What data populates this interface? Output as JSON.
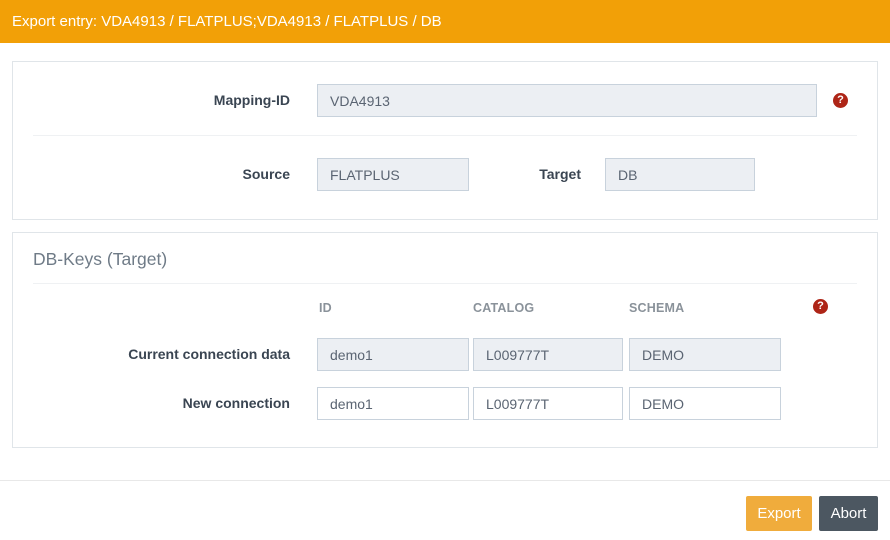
{
  "header": {
    "title": "Export entry: VDA4913 / FLATPLUS;VDA4913 / FLATPLUS / DB"
  },
  "mapping_panel": {
    "mapping_id_label": "Mapping-ID",
    "mapping_id_value": "VDA4913",
    "source_label": "Source",
    "source_value": "FLATPLUS",
    "target_label": "Target",
    "target_value": "DB"
  },
  "db_keys_panel": {
    "title": "DB-Keys (Target)",
    "columns": [
      "ID",
      "CATALOG",
      "SCHEMA"
    ],
    "rows": [
      {
        "label": "Current connection data",
        "readonly": true,
        "values": [
          "demo1",
          "L009777T",
          "DEMO"
        ]
      },
      {
        "label": "New connection",
        "readonly": false,
        "values": [
          "demo1",
          "L009777T",
          "DEMO"
        ]
      }
    ]
  },
  "footer": {
    "export_label": "Export",
    "abort_label": "Abort"
  },
  "icons": {
    "help_glyph": "?"
  },
  "colors": {
    "header_bg": "#F2A007",
    "export_button_bg": "#F0AC3C",
    "abort_button_bg": "#4C5761",
    "help_icon_bg": "#AE2517",
    "readonly_input_bg": "#ECEFF3",
    "input_border": "#C8D2DC"
  }
}
